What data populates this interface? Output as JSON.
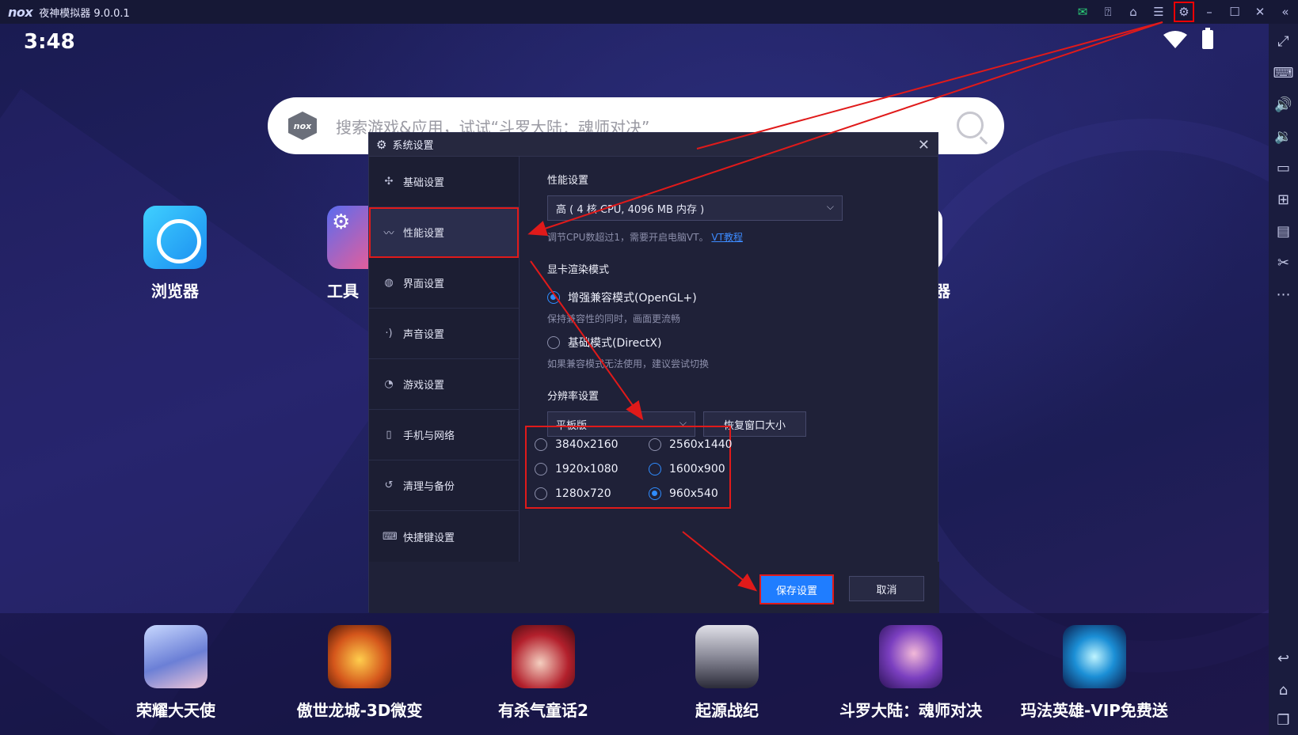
{
  "titlebar": {
    "logo": "nox",
    "title": "夜神模拟器 9.0.0.1",
    "icons": [
      "mail-icon",
      "help-icon",
      "skin-icon",
      "menu-icon",
      "settings-icon",
      "minimize-icon",
      "maximize-icon",
      "close-icon",
      "collapse-icon"
    ]
  },
  "status": {
    "time": "3:48"
  },
  "search": {
    "placeholder": "搜索游戏&应用，试试“斗罗大陆：魂师对决”"
  },
  "desktop": {
    "apps": [
      {
        "label": "浏览器"
      },
      {
        "label": "工具"
      },
      {
        "label": "器"
      }
    ]
  },
  "dock": {
    "apps": [
      {
        "label": "荣耀大天使"
      },
      {
        "label": "傲世龙城-3D微变"
      },
      {
        "label": "有杀气童话2"
      },
      {
        "label": "起源战纪"
      },
      {
        "label": "斗罗大陆：魂师对决"
      },
      {
        "label": "玛法英雄-VIP免费送"
      }
    ]
  },
  "dialog": {
    "title": "系统设置",
    "nav": [
      {
        "label": "基础设置",
        "icon": "puzzle-icon"
      },
      {
        "label": "性能设置",
        "icon": "pulse-icon",
        "active": true
      },
      {
        "label": "界面设置",
        "icon": "palette-icon"
      },
      {
        "label": "声音设置",
        "icon": "sound-icon"
      },
      {
        "label": "游戏设置",
        "icon": "gamepad-icon"
      },
      {
        "label": "手机与网络",
        "icon": "phone-icon"
      },
      {
        "label": "清理与备份",
        "icon": "history-icon"
      },
      {
        "label": "快捷键设置",
        "icon": "keyboard-icon"
      }
    ],
    "performance": {
      "title": "性能设置",
      "selected": "高 ( 4 核 CPU, 4096 MB 内存 )",
      "hint": "调节CPU数超过1，需要开启电脑VT。",
      "hint_link": "VT教程"
    },
    "render": {
      "title": "显卡渲染模式",
      "options": [
        {
          "label": "增强兼容模式(OpenGL+)",
          "desc": "保持兼容性的同时，画面更流畅",
          "selected": true
        },
        {
          "label": "基础模式(DirectX)",
          "desc": "如果兼容模式无法使用，建议尝试切换",
          "selected": false
        }
      ]
    },
    "resolution": {
      "title": "分辨率设置",
      "mode": "平板版",
      "restore_label": "恢复窗口大小",
      "options": [
        "3840x2160",
        "2560x1440",
        "1920x1080",
        "1600x900",
        "1280x720",
        "960x540"
      ],
      "selected": "960x540"
    },
    "save_label": "保存设置",
    "cancel_label": "取消"
  },
  "colors": {
    "accent": "#1f7dff",
    "annotation": "#e01a1a",
    "dialog_bg": "#1f2138"
  }
}
